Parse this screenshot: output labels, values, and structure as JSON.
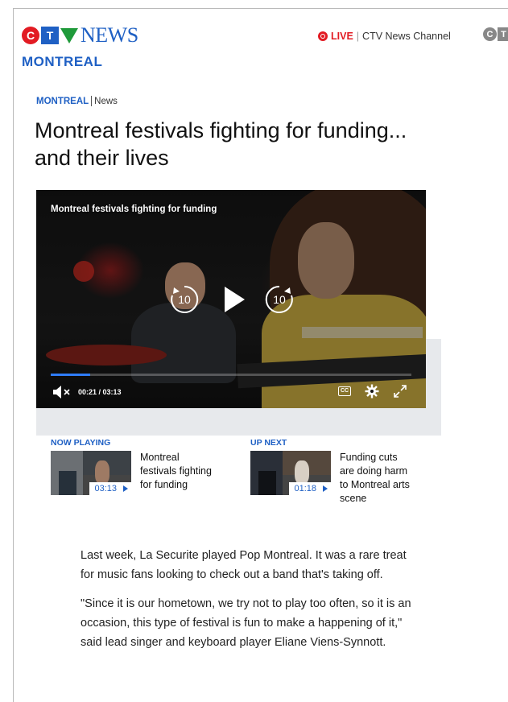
{
  "brand": {
    "logo_c": "C",
    "logo_t": "T",
    "logo_news": "NEWS",
    "region": "MONTREAL",
    "colors": {
      "red": "#e21b23",
      "blue": "#1f60c4"
    }
  },
  "live": {
    "label": "LIVE",
    "separator": "|",
    "channel": "CTV News Channel"
  },
  "corner_logo": {
    "c": "C",
    "t": "T"
  },
  "breadcrumb": {
    "region": "MONTREAL",
    "section": "News"
  },
  "headline": "Montreal festivals fighting for funding... and their lives",
  "video": {
    "title": "Montreal festivals fighting for funding",
    "rewind_seconds": "10",
    "forward_seconds": "10",
    "time_readout": "00:21 / 03:13",
    "progress_fraction": 0.11,
    "cc_label": "CC",
    "icons": {
      "rewind": "rewind-10-icon",
      "play": "play-icon",
      "forward": "forward-10-icon",
      "mute": "mute-icon",
      "cc": "closed-captions-icon",
      "settings": "gear-icon",
      "fullscreen": "fullscreen-icon"
    }
  },
  "now_playing": {
    "label": "NOW PLAYING",
    "duration": "03:13",
    "title": "Montreal festivals fighting for funding"
  },
  "up_next": {
    "label": "UP NEXT",
    "duration": "01:18",
    "title": "Funding cuts are doing harm to Montreal arts scene"
  },
  "article": {
    "paragraphs": [
      "Last week, La Securite played Pop Montreal. It was a rare treat for music fans looking to check out a band that's taking off.",
      "\"Since it is our hometown, we try not to play too often, so it is an occasion, this type of festival is fun to make a happening of it,\" said lead singer and keyboard player Eliane Viens-Synnott."
    ]
  }
}
